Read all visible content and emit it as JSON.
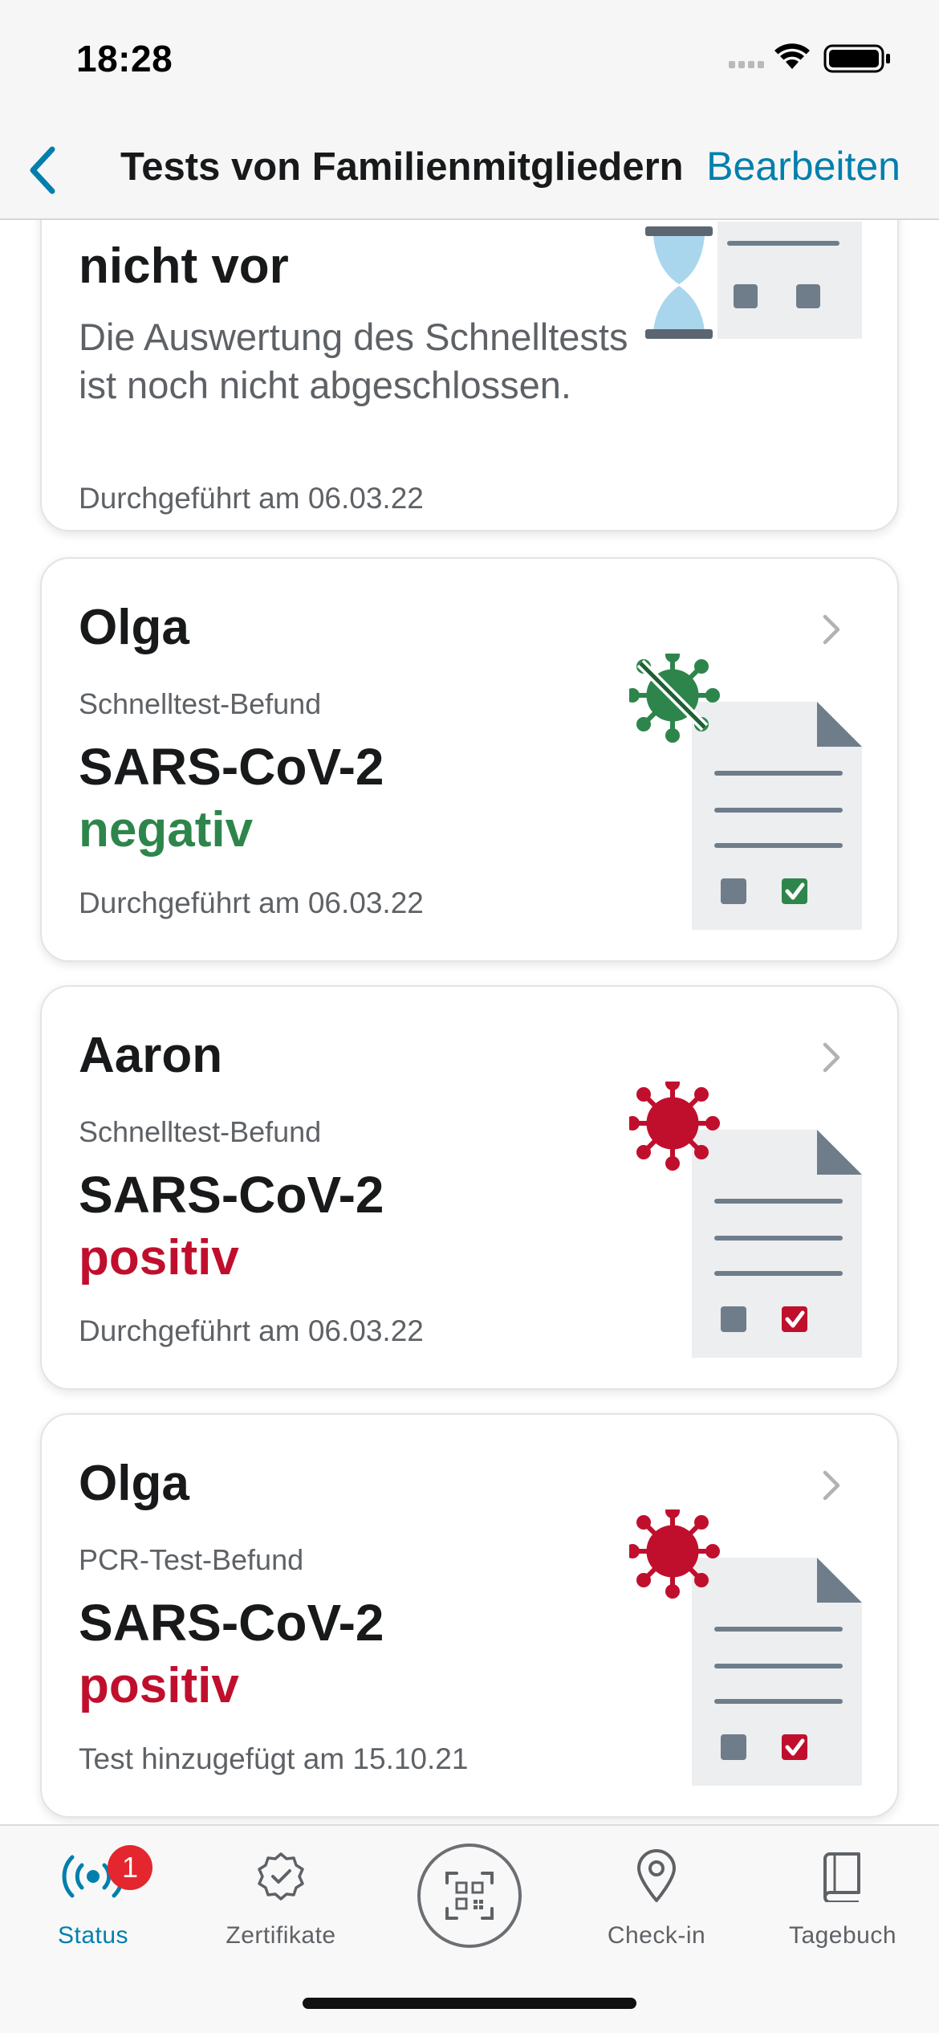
{
  "status_bar": {
    "time": "18:28"
  },
  "nav": {
    "title": "Tests von Familienmitgliedern",
    "edit_label": "Bearbeiten"
  },
  "pending_card": {
    "title": "nicht vor",
    "text": "Die Auswertung des Schnelltests ist noch nicht abgeschlossen.",
    "date": "Durchgeführt am 06.03.22"
  },
  "cards": [
    {
      "name": "Olga",
      "type": "Schnelltest-Befund",
      "pathogen": "SARS-CoV-2",
      "result": "negativ",
      "date": "Durchgeführt am 06.03.22"
    },
    {
      "name": "Aaron",
      "type": "Schnelltest-Befund",
      "pathogen": "SARS-CoV-2",
      "result": "positiv",
      "date": "Durchgeführt am 06.03.22"
    },
    {
      "name": "Olga",
      "type": "PCR-Test-Befund",
      "pathogen": "SARS-CoV-2",
      "result": "positiv",
      "date": "Test hinzugefügt am 15.10.21"
    }
  ],
  "tab_bar": {
    "status": {
      "label": "Status",
      "badge": "1"
    },
    "certificates": {
      "label": "Zertifikate"
    },
    "checkin": {
      "label": "Check-in"
    },
    "diary": {
      "label": "Tagebuch"
    }
  },
  "colors": {
    "accent": "#007fad",
    "negative": "#2e854b",
    "positive": "#c00f2d",
    "badge": "#e4262f"
  },
  "icons": {
    "back": "chevron-left-icon",
    "card_chevron": "chevron-right-icon",
    "status": "radar-icon",
    "certificates": "certificate-badge-icon",
    "scan": "qr-scan-icon",
    "checkin": "location-pin-icon",
    "diary": "book-icon"
  }
}
